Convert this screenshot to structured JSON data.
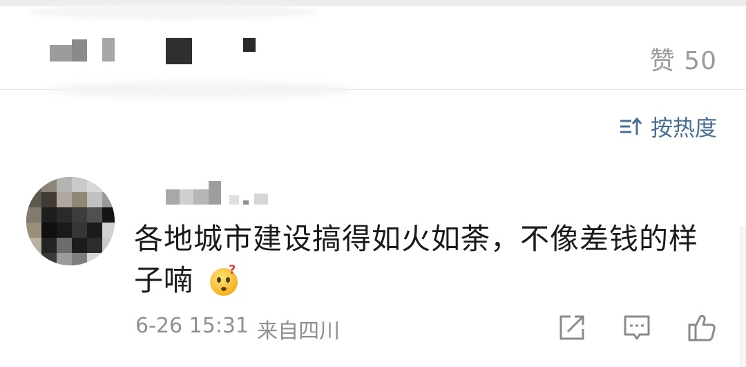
{
  "header": {
    "likes_label": "赞 50"
  },
  "sort": {
    "label": "按热度"
  },
  "comment": {
    "text": "各地城市建设搞得如火如荼，不像差钱的样子喃",
    "date": "6-26 15:31",
    "source": "来自四川",
    "emoji": "thinking-face-icon"
  },
  "actions": [
    {
      "name": "forward-icon"
    },
    {
      "name": "comment-icon"
    },
    {
      "name": "like-icon"
    }
  ],
  "colors": {
    "link_blue": "#4a6d96",
    "meta_gray": "#8f8f8f",
    "text_dark": "#1a1a1a"
  }
}
